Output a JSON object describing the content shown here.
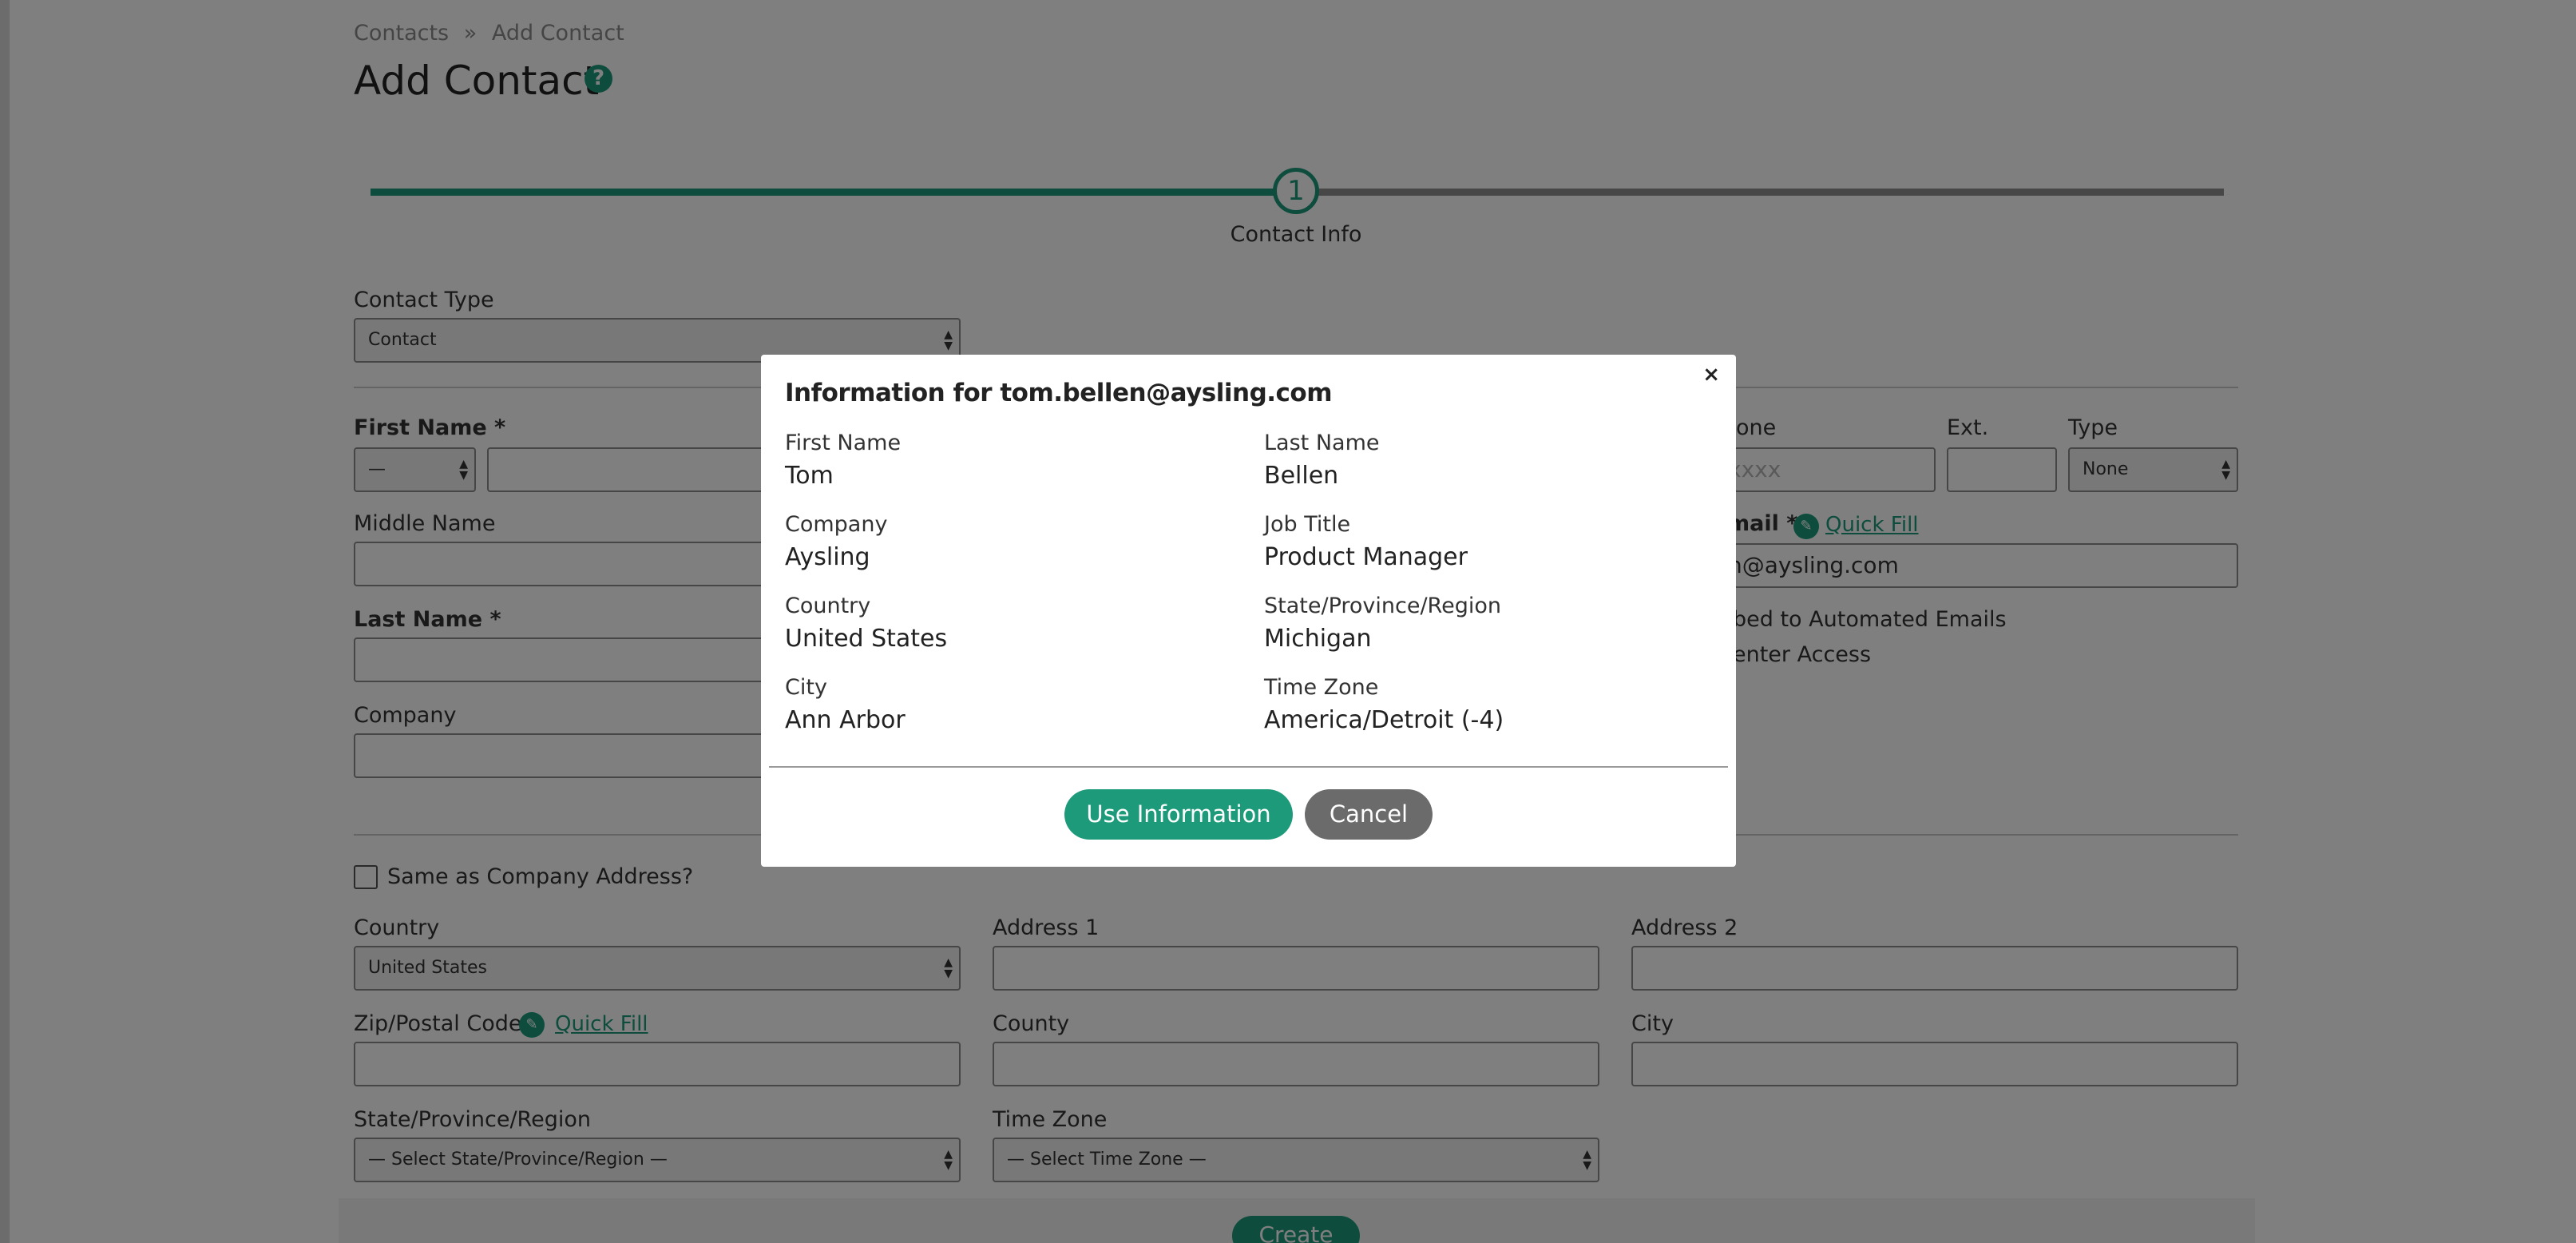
{
  "breadcrumb": {
    "root": "Contacts",
    "separator": "»",
    "current": "Add Contact"
  },
  "page": {
    "title": "Add Contact",
    "help_glyph": "?"
  },
  "stepper": {
    "step_number": "1",
    "step_label": "Contact Info"
  },
  "form": {
    "contact_type": {
      "label": "Contact Type",
      "value": "Contact"
    },
    "first_name": {
      "label": "First Name *",
      "prefix_value": "—"
    },
    "middle_name": {
      "label": "Middle Name"
    },
    "last_name": {
      "label": "Last Name *"
    },
    "company": {
      "label": "Company"
    },
    "phone": {
      "label_fragment": "one",
      "placeholder_fragment": "xxxx",
      "ext_label": "Ext.",
      "type_label": "Type",
      "type_value": "None"
    },
    "email": {
      "label_fragment": "mail *",
      "quick_fill": "Quick Fill",
      "value_fragment": "n@aysling.com"
    },
    "subscribed_fragment": "bed to Automated Emails",
    "center_access_fragment": "enter Access",
    "same_as_company": "Same as Company Address?",
    "country": {
      "label": "Country",
      "value": "United States"
    },
    "address1": {
      "label": "Address 1"
    },
    "address2": {
      "label": "Address 2"
    },
    "zip": {
      "label": "Zip/Postal Code",
      "quick_fill": "Quick Fill"
    },
    "county": {
      "label": "County"
    },
    "city": {
      "label": "City"
    },
    "state": {
      "label": "State/Province/Region",
      "value": "— Select State/Province/Region —"
    },
    "time_zone": {
      "label": "Time Zone",
      "value": "— Select Time Zone —"
    },
    "create_button": "Create"
  },
  "modal": {
    "title": "Information for tom.bellen@aysling.com",
    "close": "×",
    "fields": {
      "first_name": {
        "label": "First Name",
        "value": "Tom"
      },
      "last_name": {
        "label": "Last Name",
        "value": "Bellen"
      },
      "company": {
        "label": "Company",
        "value": "Aysling"
      },
      "job_title": {
        "label": "Job Title",
        "value": "Product Manager"
      },
      "country": {
        "label": "Country",
        "value": "United States"
      },
      "state": {
        "label": "State/Province/Region",
        "value": "Michigan"
      },
      "city": {
        "label": "City",
        "value": "Ann Arbor"
      },
      "time_zone": {
        "label": "Time Zone",
        "value": "America/Detroit (-4)"
      }
    },
    "use_button": "Use Information",
    "cancel_button": "Cancel"
  },
  "colors": {
    "accent": "#1c9a7a",
    "cancel": "#6b6b6b",
    "overlay": "rgba(0,0,0,0.5)"
  }
}
